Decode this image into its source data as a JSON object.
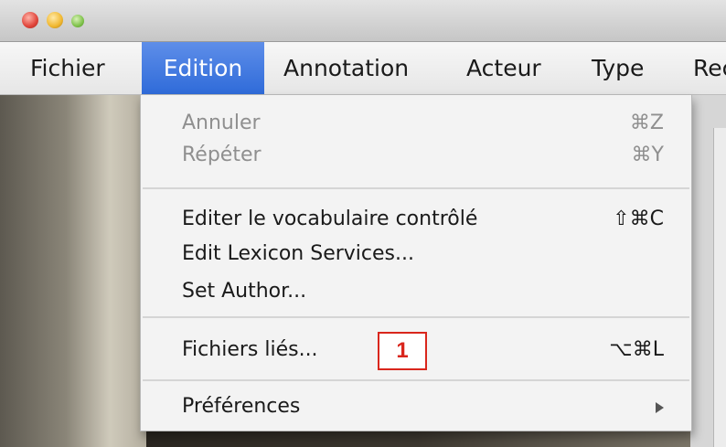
{
  "menubar": {
    "items": [
      {
        "label": "Fichier"
      },
      {
        "label": "Edition",
        "active": true
      },
      {
        "label": "Annotation"
      },
      {
        "label": "Acteur"
      },
      {
        "label": "Type"
      },
      {
        "label": "Rec"
      }
    ]
  },
  "dropdown": {
    "undo": {
      "label": "Annuler",
      "shortcut": "⌘Z",
      "enabled": false
    },
    "redo": {
      "label": "Répéter",
      "shortcut": "⌘Y",
      "enabled": false
    },
    "edit_vocab": {
      "label": "Editer le vocabulaire contrôlé",
      "shortcut": "⇧⌘C"
    },
    "lexicon": {
      "label": "Edit Lexicon Services..."
    },
    "author": {
      "label": "Set Author..."
    },
    "linked_files": {
      "label": "Fichiers liés...",
      "shortcut": "⌥⌘L"
    },
    "preferences": {
      "label": "Préférences",
      "submenu_icon": "submenu-arrow-icon"
    }
  },
  "callout": {
    "text": "1",
    "color": "#d9261c"
  },
  "colors": {
    "menu_highlight": "#2f6bd9",
    "disabled_text": "#8f8f8f"
  }
}
